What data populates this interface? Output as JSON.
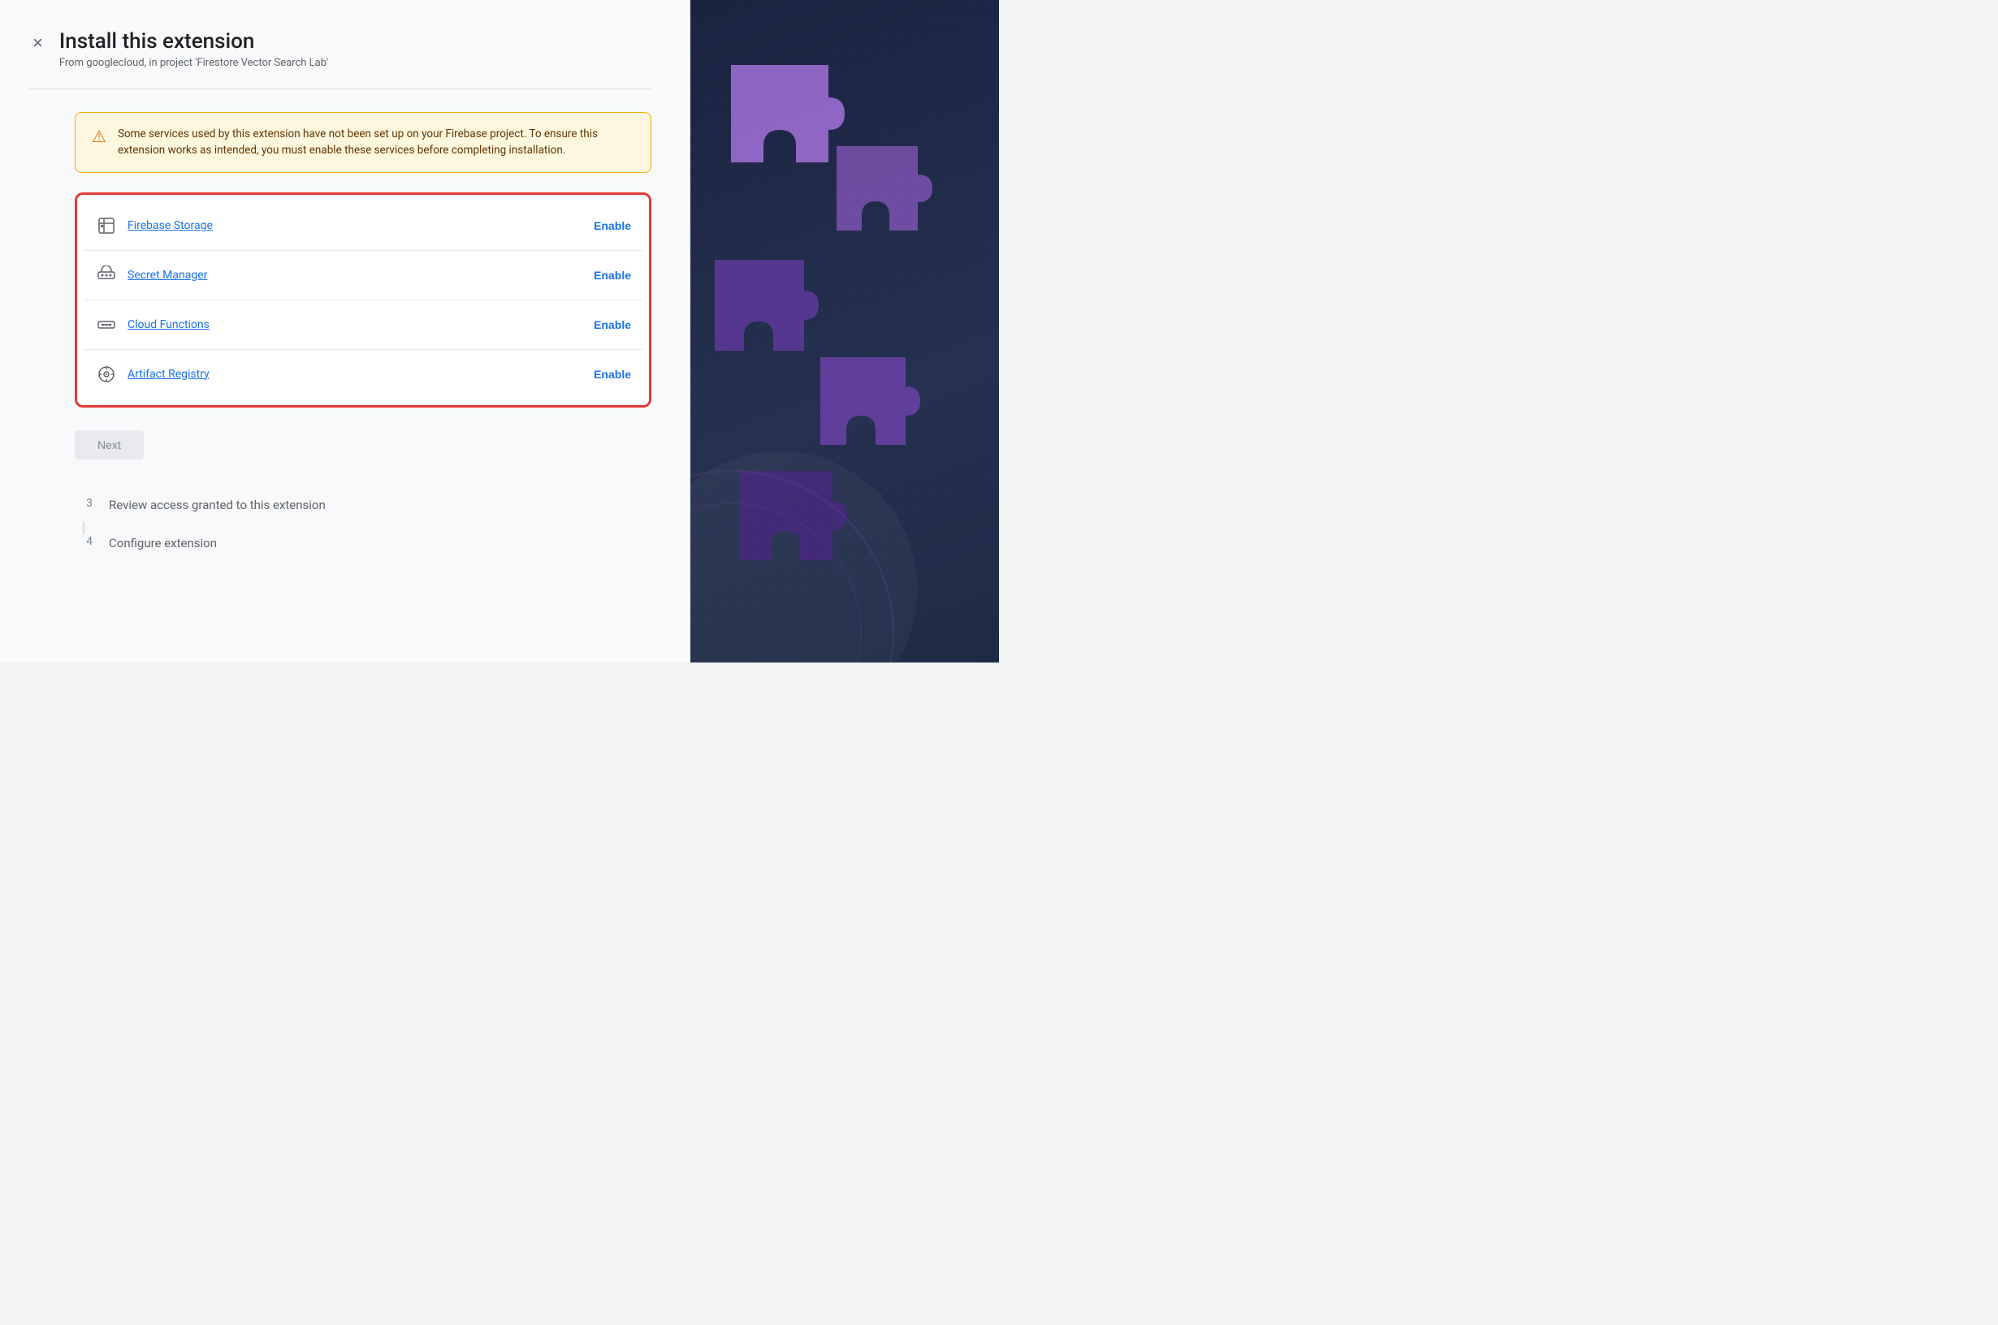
{
  "header": {
    "title": "Install this extension",
    "subtitle": "From googlecloud, in project 'Firestore Vector Search Lab'",
    "close_label": "×"
  },
  "warning": {
    "text": "Some services used by this extension have not been set up on your Firebase project. To ensure this extension works as intended, you must enable these services before completing installation."
  },
  "services": [
    {
      "name": "Firebase Storage",
      "icon": "storage",
      "enable_label": "Enable"
    },
    {
      "name": "Secret Manager",
      "icon": "secret",
      "enable_label": "Enable"
    },
    {
      "name": "Cloud Functions",
      "icon": "functions",
      "enable_label": "Enable"
    },
    {
      "name": "Artifact Registry",
      "icon": "artifact",
      "enable_label": "Enable"
    }
  ],
  "next_button_label": "Next",
  "steps": [
    {
      "number": "3",
      "label": "Review access granted to this extension"
    },
    {
      "number": "4",
      "label": "Configure extension"
    }
  ]
}
